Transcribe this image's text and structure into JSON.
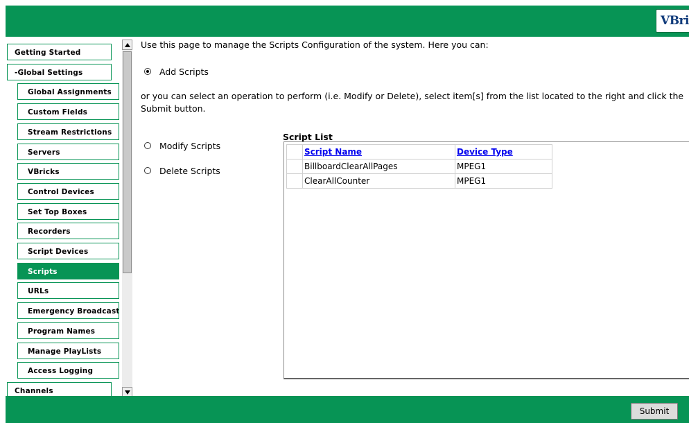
{
  "header": {
    "logo_text": "VBrick"
  },
  "sidebar": {
    "items": [
      {
        "label": "Getting Started",
        "level": "top",
        "active": false
      },
      {
        "label": "-Global Settings",
        "level": "top",
        "active": false
      },
      {
        "label": "Global Assignments",
        "level": "sub",
        "active": false
      },
      {
        "label": "Custom Fields",
        "level": "sub",
        "active": false
      },
      {
        "label": "Stream Restrictions",
        "level": "sub",
        "active": false
      },
      {
        "label": "Servers",
        "level": "sub",
        "active": false
      },
      {
        "label": "VBricks",
        "level": "sub",
        "active": false
      },
      {
        "label": "Control Devices",
        "level": "sub",
        "active": false
      },
      {
        "label": "Set Top Boxes",
        "level": "sub",
        "active": false
      },
      {
        "label": "Recorders",
        "level": "sub",
        "active": false
      },
      {
        "label": "Script Devices",
        "level": "sub",
        "active": false
      },
      {
        "label": "Scripts",
        "level": "sub",
        "active": true
      },
      {
        "label": "URLs",
        "level": "sub",
        "active": false
      },
      {
        "label": "Emergency Broadcast",
        "level": "sub",
        "active": false
      },
      {
        "label": "Program Names",
        "level": "sub",
        "active": false
      },
      {
        "label": "Manage PlayLists",
        "level": "sub",
        "active": false
      },
      {
        "label": "Access Logging",
        "level": "sub",
        "active": false
      },
      {
        "label": "Channels",
        "level": "top",
        "active": false
      }
    ]
  },
  "main": {
    "intro": "Use this page to manage the Scripts Configuration of the system. Here you can:",
    "add_label": "Add Scripts",
    "description": "or you can select an operation to perform (i.e. Modify or Delete), select item[s] from the list located to the right and click the Submit button.",
    "modify_label": "Modify Scripts",
    "delete_label": "Delete Scripts",
    "selected_operation": "Add Scripts",
    "script_list": {
      "title": "Script List",
      "columns": [
        "Script Name",
        "Device Type"
      ],
      "rows": [
        [
          "BillboardClearAllPages",
          "MPEG1"
        ],
        [
          "ClearAllCounter",
          "MPEG1"
        ]
      ]
    }
  },
  "footer": {
    "submit_label": "Submit"
  },
  "colors": {
    "brand_green": "#079455",
    "link_blue": "#0000ee",
    "logo_navy": "#0f3a7a"
  }
}
